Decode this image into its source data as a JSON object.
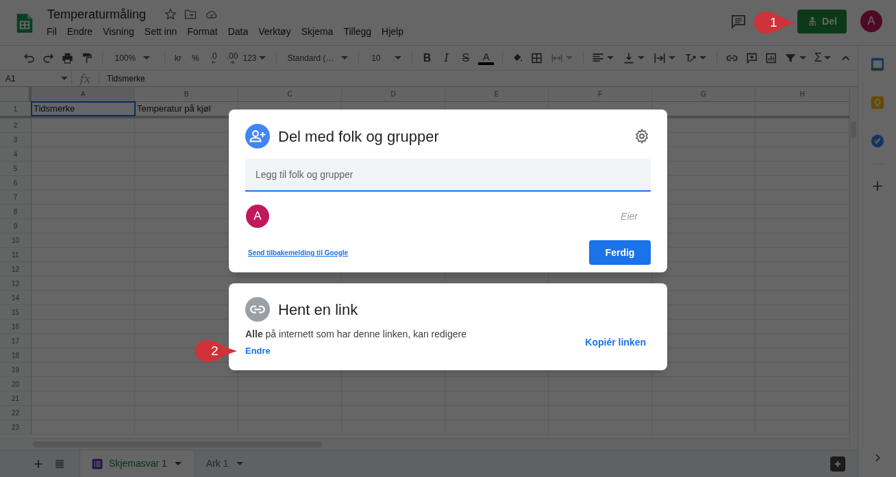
{
  "app": {
    "title": "Temperaturmåling",
    "menu": [
      "Fil",
      "Endre",
      "Visning",
      "Sett inn",
      "Format",
      "Data",
      "Verktøy",
      "Skjema",
      "Tillegg",
      "Hjelp"
    ],
    "share_button": "Del",
    "avatar": "A"
  },
  "toolbar": {
    "zoom": "100%",
    "currency": "kr",
    "percent": "%",
    "decrease_decimals": ".0",
    "increase_decimals": ".00",
    "number_format": "123",
    "font": "Standard (…",
    "font_size": "10",
    "bold": "B",
    "italic": "I",
    "strikethrough": "S",
    "text_color": "A",
    "sum": "Σ"
  },
  "formula_bar": {
    "cell_ref": "A1",
    "fx": "fx",
    "value": "Tidsmerke"
  },
  "grid": {
    "columns": [
      "A",
      "B",
      "C",
      "D",
      "E",
      "F",
      "G",
      "H"
    ],
    "rows": [
      "1",
      "2",
      "3",
      "4",
      "5",
      "6",
      "7",
      "8",
      "9",
      "10",
      "11",
      "12",
      "13",
      "14",
      "15",
      "16",
      "17",
      "18",
      "19",
      "20",
      "21",
      "22",
      "23"
    ],
    "cells": [
      [
        "Tidsmerke",
        "Temperatur på kjøl"
      ]
    ]
  },
  "sheets": [
    {
      "label": "Skjemasvar 1",
      "selected": true
    },
    {
      "label": "Ark 1",
      "selected": false
    }
  ],
  "share_dialog": {
    "title": "Del med folk og grupper",
    "placeholder": "Legg til folk og grupper",
    "people": [
      {
        "avatar": "A",
        "role": "Eier"
      }
    ],
    "feedback_link": "Send tilbakemelding til Google",
    "done_button": "Ferdig"
  },
  "link_dialog": {
    "title": "Hent en link",
    "description": "**Alle** på internett som har denne linken, kan redigere",
    "change_link": "Endre",
    "copy_link": "Kopiér linken"
  },
  "callouts": [
    {
      "label": "1"
    },
    {
      "label": "2"
    }
  ]
}
